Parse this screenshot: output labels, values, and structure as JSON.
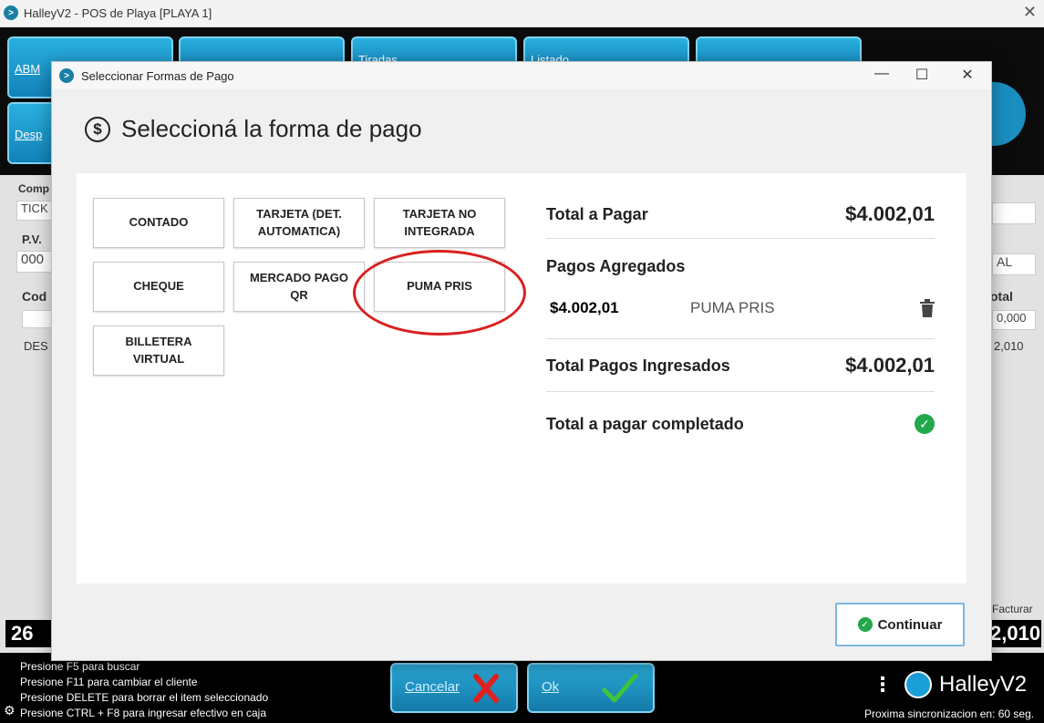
{
  "app": {
    "title": "HalleyV2 - POS de Playa [PLAYA 1]",
    "toolbar": {
      "abm_label": "ABM",
      "desp_label": "Desp",
      "tiradas_label": "Tiradas",
      "listado_label": "Listado"
    },
    "background": {
      "comp_label": "Comp",
      "tick_value": "TICK",
      "pv_label": "P.V.",
      "pv_value": "000",
      "cod_label": "Cod",
      "des_value": "DES",
      "total_label": "otal",
      "al_value": "AL",
      "val1": "0,000",
      "val2": "2,010",
      "facturar_label": "Facturar",
      "big_left": "26",
      "big_right": "2,010"
    },
    "footer": {
      "hints": [
        "Presione F5 para buscar",
        "Presione F11 para cambiar el cliente",
        "Presione DELETE para borrar el item seleccionado",
        "Presione CTRL + F8 para ingresar efectivo en caja"
      ],
      "cancel_label": "Cancelar",
      "ok_label": "Ok",
      "brand": "HalleyV2",
      "sync_text": "Proxima sincronizacion en: 60 seg."
    }
  },
  "dialog": {
    "title": "Seleccionar Formas de Pago",
    "heading": "Seleccioná la forma de pago",
    "payment_methods": [
      "CONTADO",
      "TARJETA (DET. AUTOMATICA)",
      "TARJETA NO INTEGRADA",
      "CHEQUE",
      "MERCADO PAGO QR",
      "PUMA PRIS",
      "BILLETERA VIRTUAL"
    ],
    "summary": {
      "total_label": "Total a Pagar",
      "total_value": "$4.002,01",
      "pagos_label": "Pagos Agregados",
      "pago_amount": "$4.002,01",
      "pago_name": "PUMA PRIS",
      "ingresados_label": "Total Pagos Ingresados",
      "ingresados_value": "$4.002,01",
      "completado_label": "Total a pagar completado"
    },
    "continue_label": "Continuar"
  }
}
